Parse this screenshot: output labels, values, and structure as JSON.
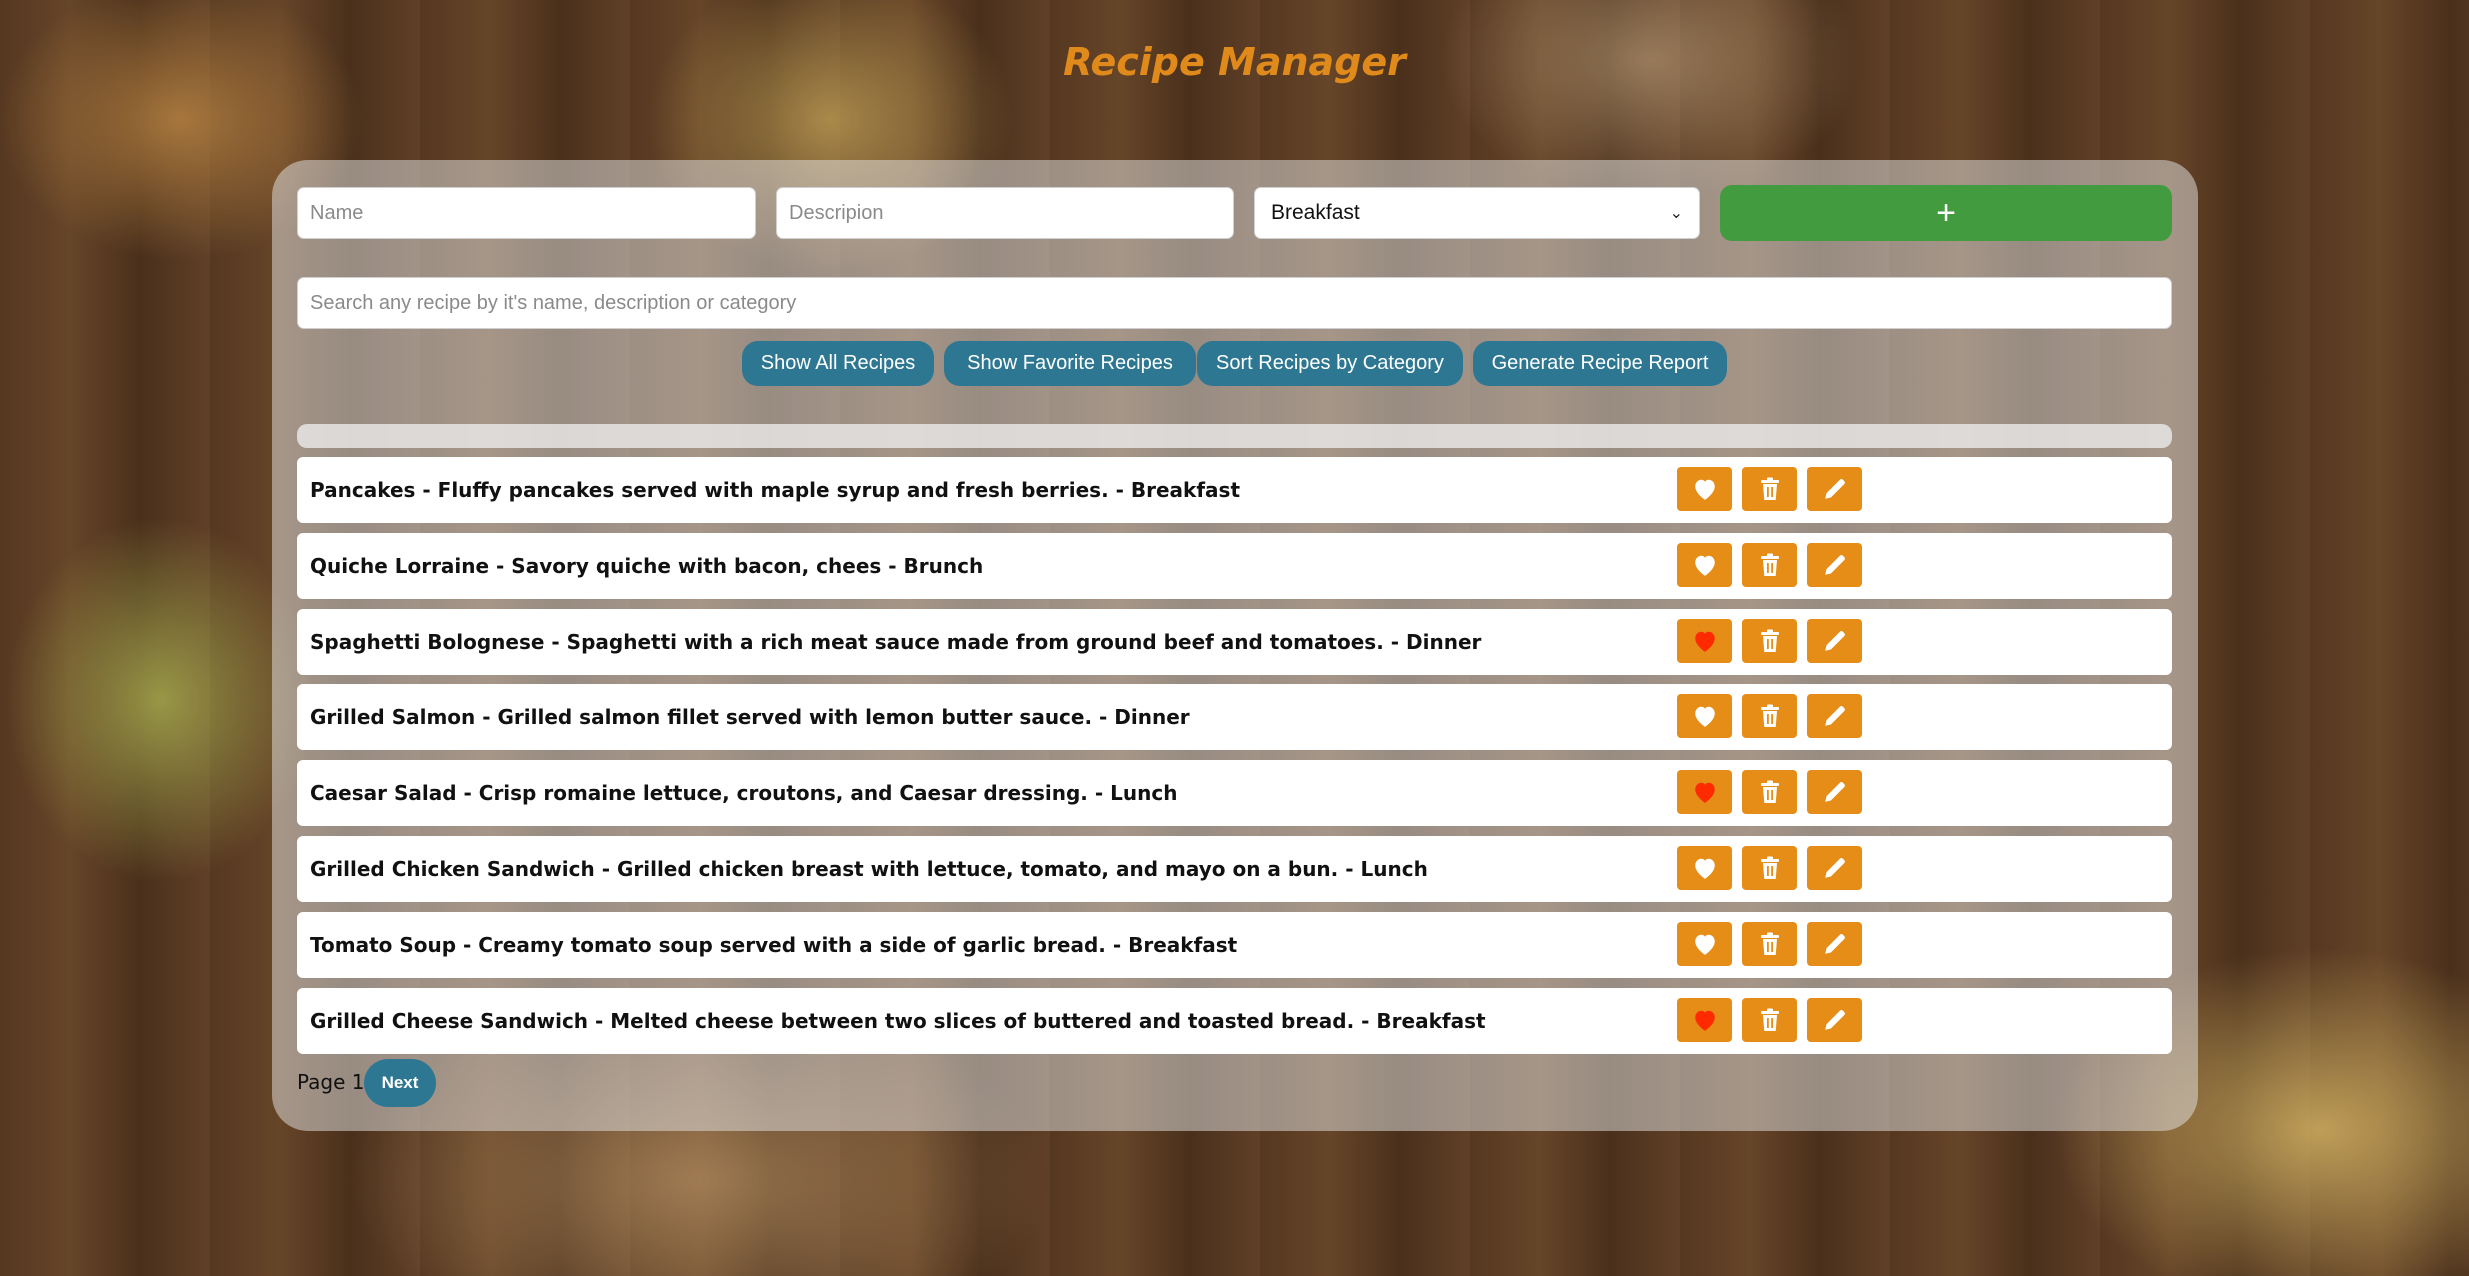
{
  "app": {
    "title": "Recipe Manager"
  },
  "form": {
    "name_placeholder": "Name",
    "name_value": "",
    "description_placeholder": "Descripion",
    "description_value": "",
    "category_selected": "Breakfast",
    "add_label": "+"
  },
  "search": {
    "placeholder": "Search any recipe by it's name, description or category",
    "value": ""
  },
  "toolbar": {
    "show_all": "Show All Recipes",
    "show_favorites": "Show Favorite Recipes",
    "sort_by_category": "Sort Recipes by Category",
    "generate_report": "Generate Recipe Report"
  },
  "recipes": [
    {
      "text": "Pancakes - Fluffy pancakes served with maple syrup and fresh berries. - Breakfast",
      "favorite": false
    },
    {
      "text": "Quiche Lorraine - Savory quiche with bacon, chees - Brunch",
      "favorite": false
    },
    {
      "text": "Spaghetti Bolognese - Spaghetti with a rich meat sauce made from ground beef and tomatoes. - Dinner",
      "favorite": true
    },
    {
      "text": "Grilled Salmon - Grilled salmon fillet served with lemon butter sauce. - Dinner",
      "favorite": false
    },
    {
      "text": "Caesar Salad - Crisp romaine lettuce, croutons, and Caesar dressing. - Lunch",
      "favorite": true
    },
    {
      "text": "Grilled Chicken Sandwich - Grilled chicken breast with lettuce, tomato, and mayo on a bun. - Lunch",
      "favorite": false
    },
    {
      "text": "Tomato Soup - Creamy tomato soup served with a side of garlic bread. - Breakfast",
      "favorite": false
    },
    {
      "text": "Grilled Cheese Sandwich - Melted cheese between two slices of buttered and toasted bread. - Breakfast",
      "favorite": true
    }
  ],
  "actions": {
    "favorite_icon": "heart-icon",
    "delete_icon": "trash-icon",
    "edit_icon": "pencil-icon"
  },
  "pagination": {
    "page_label": "Page 1",
    "next_label": "Next"
  },
  "colors": {
    "title": "#e08a1c",
    "accent_button": "#2e7792",
    "add_button": "#429b3e",
    "action_button": "#e58d17",
    "favorite_heart": "#ff2a00",
    "unfavorite_heart": "#ffffff"
  }
}
